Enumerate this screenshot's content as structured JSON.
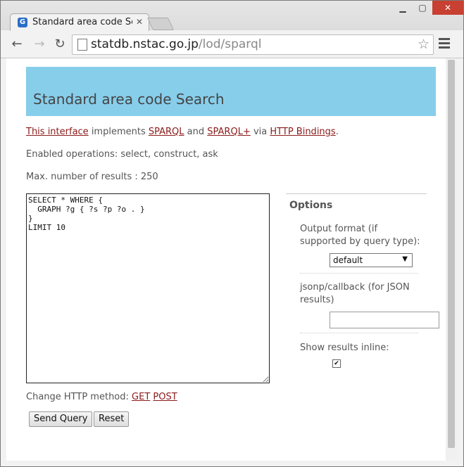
{
  "browser": {
    "tab_title": "Standard area code Sea",
    "tab_favicon_letter": "G",
    "url_host": "statdb.nstac.go.jp",
    "url_path": "/lod/sparql"
  },
  "page": {
    "heading": "Standard area code Search",
    "intro": {
      "link1": "This interface",
      "text1": " implements ",
      "link2": "SPARQL",
      "text2": " and ",
      "link3": "SPARQL+",
      "text3": " via ",
      "link4": "HTTP Bindings",
      "text4": "."
    },
    "enabled_ops": "Enabled operations: select, construct, ask",
    "max_results": "Max. number of results : 250",
    "query_text": "SELECT * WHERE {\n  GRAPH ?g { ?s ?p ?o . }\n}\nLIMIT 10",
    "http_method_label": "Change HTTP method: ",
    "http_get": "GET",
    "http_post": "POST",
    "send_query": "Send Query",
    "reset": "Reset"
  },
  "options": {
    "title": "Options",
    "output_format_label": "Output format (if supported by query type):",
    "output_format_value": "default",
    "jsonp_label": "jsonp/callback (for JSON results)",
    "jsonp_value": "",
    "show_inline_label": "Show results inline:",
    "show_inline_checked": true
  }
}
